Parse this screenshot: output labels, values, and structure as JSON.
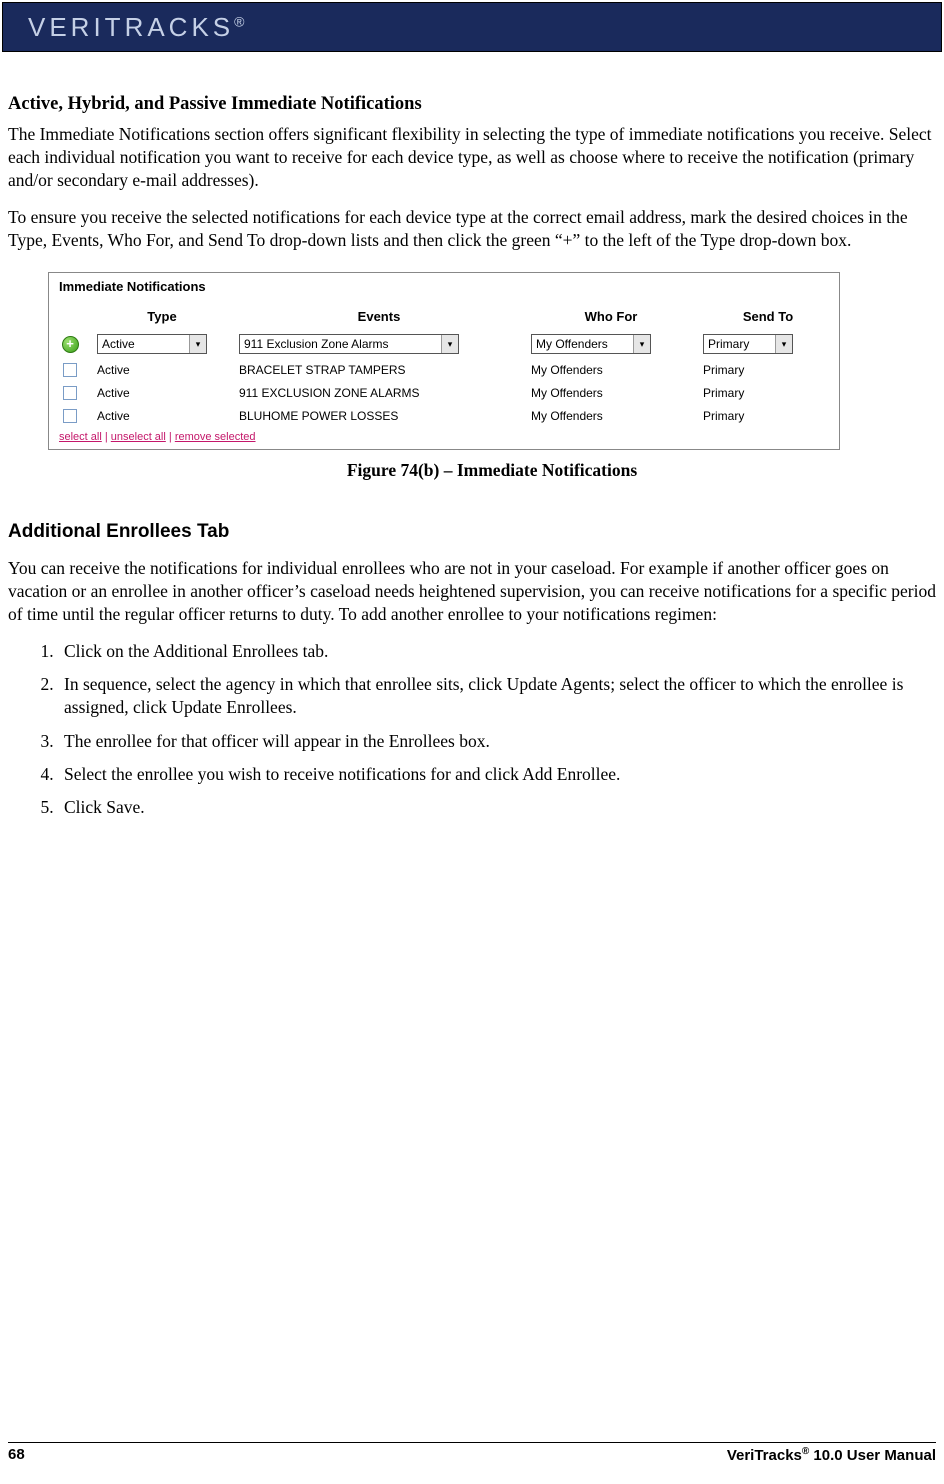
{
  "header": {
    "brand": "VERITRACKS",
    "brand_suffix": "®"
  },
  "section1": {
    "heading": "Active, Hybrid, and Passive Immediate Notifications",
    "para1": "The Immediate Notifications section offers significant flexibility in selecting the type of immediate notifications you receive. Select each individual notification you want to receive for each device type, as well as choose where to receive the notification (primary and/or secondary e-mail addresses).",
    "para2": "To ensure you receive the selected notifications for each device type at the correct email address, mark the desired choices in the Type, Events, Who For, and Send To drop-down lists and then click the green “+” to the left of the Type drop-down box."
  },
  "figure": {
    "panel_title": "Immediate Notifications",
    "cols": {
      "type": "Type",
      "events": "Events",
      "whofor": "Who For",
      "sendto": "Send To"
    },
    "input_row": {
      "type": "Active",
      "events": "911 Exclusion Zone Alarms",
      "whofor": "My Offenders",
      "sendto": "Primary"
    },
    "rows": [
      {
        "type": "Active",
        "events": "BRACELET STRAP TAMPERS",
        "whofor": "My Offenders",
        "sendto": "Primary"
      },
      {
        "type": "Active",
        "events": "911 EXCLUSION ZONE ALARMS",
        "whofor": "My Offenders",
        "sendto": "Primary"
      },
      {
        "type": "Active",
        "events": "BLUHOME POWER LOSSES",
        "whofor": "My Offenders",
        "sendto": "Primary"
      }
    ],
    "links": {
      "select_all": "select all",
      "unselect_all": "unselect all",
      "remove_selected": "remove selected",
      "sep": " | "
    },
    "caption": "Figure 74(b) – Immediate Notifications"
  },
  "section2": {
    "heading": "Additional Enrollees Tab",
    "intro": "You can receive the notifications for individual enrollees who are not in your caseload.  For example if another officer goes on vacation or an enrollee in another officer’s caseload needs heightened supervision, you can receive notifications for a specific period of time until the regular officer returns to duty. To add another enrollee to your notifications regimen:",
    "steps": [
      "Click on the Additional Enrollees tab.",
      "In sequence, select the agency in which that enrollee sits, click Update Agents; select the officer to which the enrollee is assigned, click Update Enrollees.",
      "The enrollee for that officer will appear in the Enrollees box.",
      "Select the enrollee you wish to receive notifications for and click Add Enrollee.",
      "Click Save."
    ]
  },
  "footer": {
    "page_num": "68",
    "manual": "VeriTracks",
    "manual_sup": "®",
    "manual_suffix": " 10.0 User Manual"
  }
}
